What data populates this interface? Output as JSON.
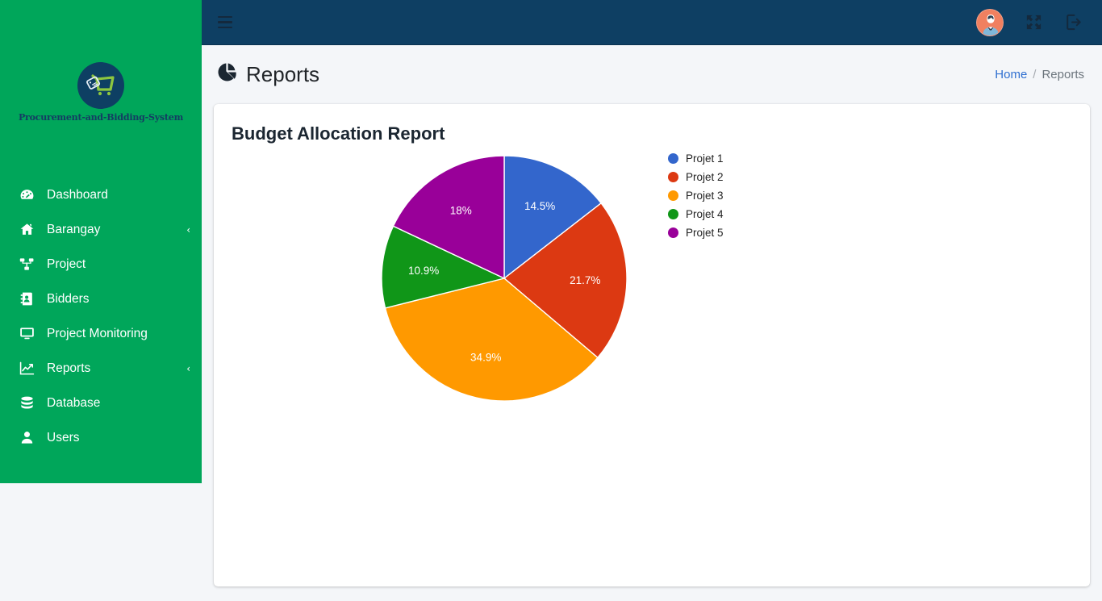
{
  "app": {
    "brand_name": "Procurement-and-Bidding-System",
    "logo_icon": "shopping-cart-tag-logo-icon"
  },
  "navbar": {
    "hamburger_icon": "hamburger-menu-icon",
    "avatar_icon": "user-avatar-icon",
    "fullscreen_icon": "expand-fullscreen-icon",
    "logout_icon": "logout-sign-out-icon"
  },
  "sidebar": {
    "items": [
      {
        "label": "Dashboard",
        "icon": "tachometer-dashboard-icon",
        "caret": ""
      },
      {
        "label": "Barangay",
        "icon": "home-icon",
        "caret": "‹"
      },
      {
        "label": "Project",
        "icon": "project-diagram-icon",
        "caret": ""
      },
      {
        "label": "Bidders",
        "icon": "address-book-icon",
        "caret": ""
      },
      {
        "label": "Project Monitoring",
        "icon": "desktop-monitor-icon",
        "caret": ""
      },
      {
        "label": "Reports",
        "icon": "chart-line-icon",
        "caret": "‹"
      },
      {
        "label": "Database",
        "icon": "database-icon",
        "caret": ""
      },
      {
        "label": "Users",
        "icon": "user-icon",
        "caret": ""
      }
    ]
  },
  "content": {
    "page_title": "Reports",
    "page_title_icon": "pie-chart-icon",
    "breadcrumb": {
      "home": "Home",
      "separator": "/",
      "current": "Reports"
    },
    "card_title": "Budget Allocation Report"
  },
  "chart_data": {
    "type": "pie",
    "title": "Budget Allocation Report",
    "categories": [
      "Projet 1",
      "Projet 2",
      "Projet 3",
      "Projet 4",
      "Projet 5"
    ],
    "values": [
      14.5,
      21.7,
      34.9,
      10.9,
      18.0
    ],
    "labels": [
      "14.5%",
      "21.7%",
      "34.9%",
      "10.9%",
      "18%"
    ],
    "colors": [
      "#3366cc",
      "#dc3912",
      "#ff9900",
      "#109618",
      "#990099"
    ],
    "legend_position": "right",
    "label_color": "#ffffff",
    "start_angle_deg": 0,
    "direction": "clockwise",
    "grid": false
  },
  "theme": {
    "sidebar_bg": "#00a65a",
    "navbar_bg": "#0e3f63",
    "page_bg": "#f4f6f9",
    "card_bg": "#ffffff",
    "link_color": "#2f6fd0",
    "brand_text_color": "#143c63",
    "avatar_bg": "#f08060"
  }
}
